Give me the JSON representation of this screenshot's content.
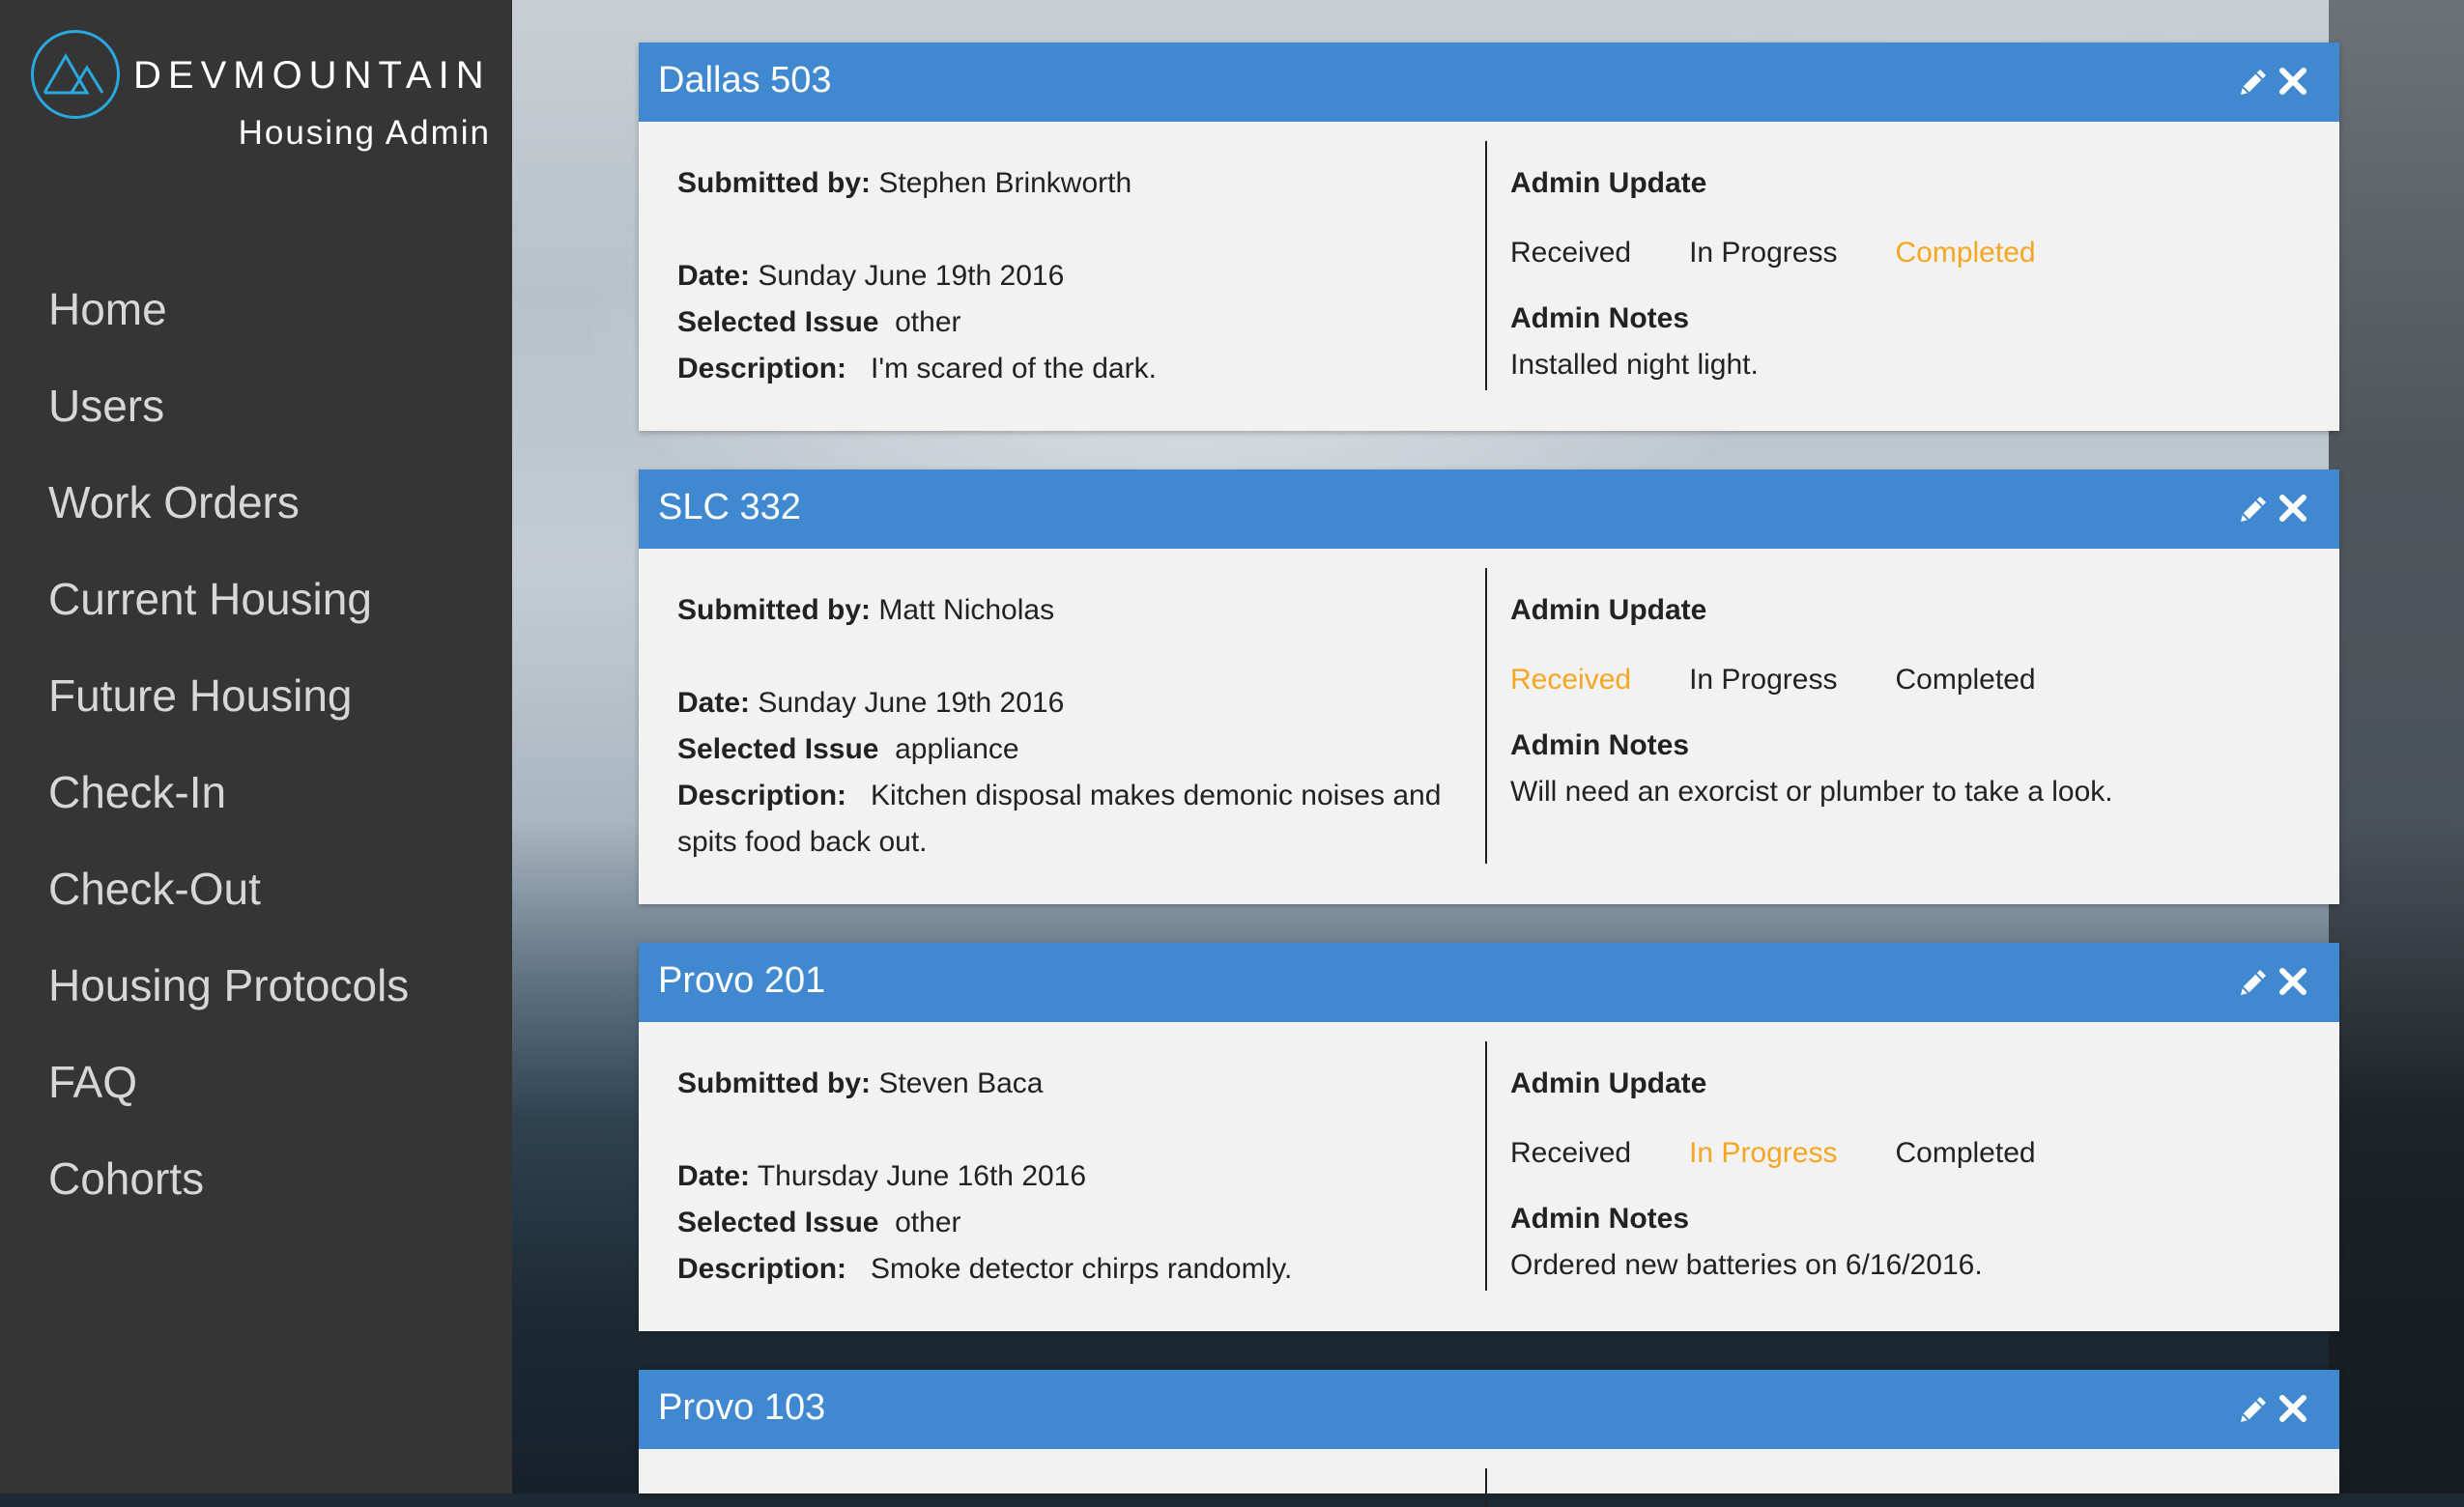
{
  "brand": {
    "name": "DEVMOUNTAIN",
    "subtitle": "Housing Admin",
    "accent": "#2aa8e0"
  },
  "nav": [
    {
      "label": "Home"
    },
    {
      "label": "Users"
    },
    {
      "label": "Work Orders"
    },
    {
      "label": "Current Housing"
    },
    {
      "label": "Future Housing"
    },
    {
      "label": "Check-In"
    },
    {
      "label": "Check-Out"
    },
    {
      "label": "Housing Protocols"
    },
    {
      "label": "FAQ"
    },
    {
      "label": "Cohorts"
    }
  ],
  "labels": {
    "submitted_by": "Submitted by:",
    "date": "Date:",
    "selected_issue": "Selected Issue",
    "description": "Description:",
    "admin_update": "Admin Update",
    "admin_notes": "Admin Notes",
    "status_received": "Received",
    "status_in_progress": "In Progress",
    "status_completed": "Completed"
  },
  "colors": {
    "header_blue": "#4089d1",
    "active_status": "#f5a623",
    "sidebar": "#353535"
  },
  "work_orders": [
    {
      "title": "Dallas 503",
      "submitted_by": "Stephen Brinkworth",
      "date": "Sunday June 19th 2016",
      "issue": "other",
      "description": "I'm scared of the dark.",
      "status": "Completed",
      "notes": "Installed night light."
    },
    {
      "title": "SLC 332",
      "submitted_by": "Matt Nicholas",
      "date": "Sunday June 19th 2016",
      "issue": "appliance",
      "description": "Kitchen disposal makes demonic noises and spits food back out.",
      "status": "Received",
      "notes": "Will need an exorcist or plumber to take a look."
    },
    {
      "title": "Provo 201",
      "submitted_by": "Steven Baca",
      "date": "Thursday June 16th 2016",
      "issue": "other",
      "description": "Smoke detector chirps randomly.",
      "status": "In Progress",
      "notes": "Ordered new batteries on 6/16/2016."
    },
    {
      "title": "Provo 103"
    }
  ]
}
